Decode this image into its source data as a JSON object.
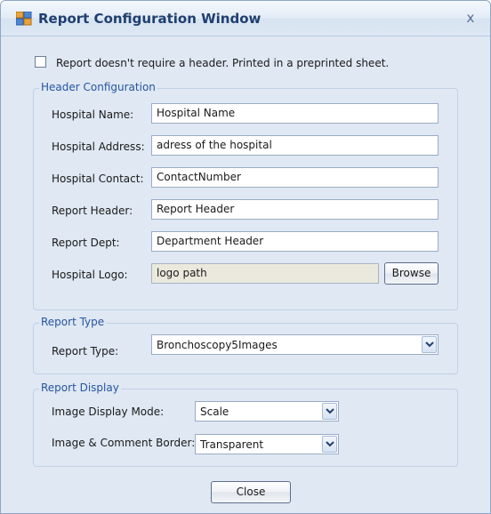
{
  "window": {
    "title": "Report Configuration Window",
    "close_glyph": "x",
    "title_icon": "app-window-icon",
    "accent_color": "#1f3f6f",
    "legend_color": "#2755a0"
  },
  "header_checkbox": {
    "checked": false,
    "label": "Report doesn't require a header. Printed in a preprinted sheet."
  },
  "header_config": {
    "legend": "Header Configuration",
    "fields": [
      {
        "label": "Hospital Name:",
        "value": "Hospital Name"
      },
      {
        "label": "Hospital Address:",
        "value": "adress of the hospital"
      },
      {
        "label": "Hospital Contact:",
        "value": "ContactNumber"
      },
      {
        "label": "Report Header:",
        "value": "Report Header"
      },
      {
        "label": "Report Dept:",
        "value": "Department Header"
      }
    ],
    "logo": {
      "label": "Hospital Logo:",
      "value": "logo path",
      "browse_label": "Browse"
    }
  },
  "report_type": {
    "legend": "Report Type",
    "label": "Report Type:",
    "selected": "Bronchoscopy5Images"
  },
  "report_display": {
    "legend": "Report Display",
    "display_mode_label": "Image Display Mode:",
    "display_mode_selected": "Scale",
    "border_label": "Image & Comment Border:",
    "border_selected": "Transparent"
  },
  "footer": {
    "close_label": "Close"
  }
}
